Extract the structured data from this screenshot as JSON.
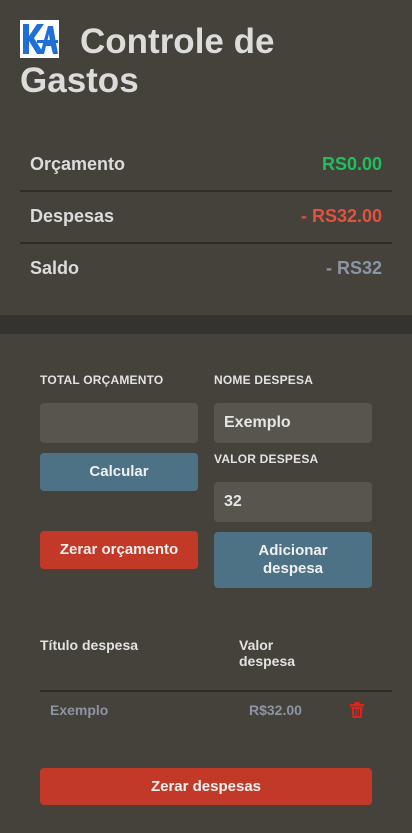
{
  "header": {
    "title": "Controle de Gastos",
    "logo_text": "KA"
  },
  "summary": {
    "budget_label": "Orçamento",
    "budget_value": "RS0.00",
    "expenses_label": "Despesas",
    "expenses_value": "- RS32.00",
    "balance_label": "Saldo",
    "balance_value": "- RS32"
  },
  "form": {
    "budget_label": "TOTAL ORÇAMENTO",
    "budget_value": "",
    "calculate_button": "Calcular",
    "reset_budget_button": "Zerar orçamento",
    "expense_name_label": "NOME DESPESA",
    "expense_name_value": "Exemplo",
    "expense_value_label": "VALOR DESPESA",
    "expense_value_value": "32",
    "add_expense_button": "Adicionar despesa"
  },
  "table": {
    "col_title": "Título despesa",
    "col_value": "Valor despesa",
    "rows": [
      {
        "title": "Exemplo",
        "value": "R$32.00"
      }
    ]
  },
  "reset_expenses_button": "Zerar despesas",
  "colors": {
    "positive": "#1fbf5c",
    "negative": "#e0533f",
    "neutral": "#8d94a3",
    "accent_blue": "#4d7285",
    "accent_red": "#c23a27"
  }
}
